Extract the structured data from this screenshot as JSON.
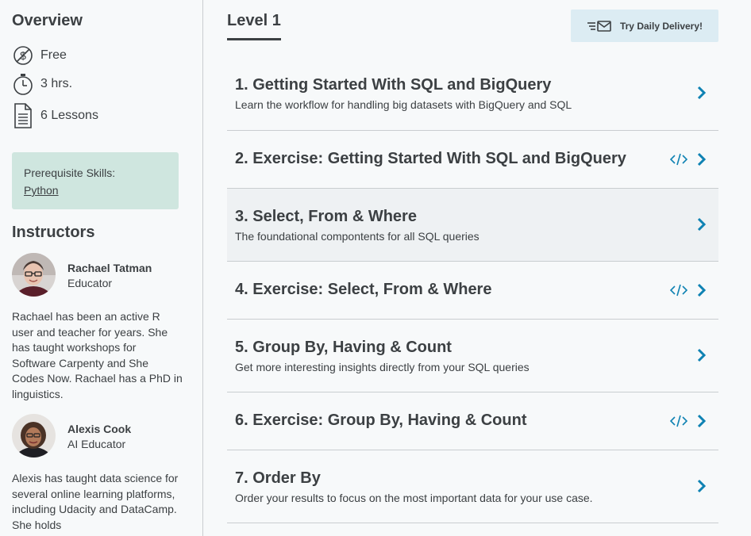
{
  "overview": {
    "title": "Overview",
    "price": "Free",
    "duration": "3 hrs.",
    "lessons_count": "6 Lessons",
    "prereq_label": "Prerequisite Skills:",
    "prereq_link": "Python"
  },
  "instructors": {
    "title": "Instructors",
    "items": [
      {
        "name": "Rachael Tatman",
        "role": "Educator",
        "bio": "Rachael has been an active R user and teacher for years. She has taught workshops for Software Carpenty and She Codes Now. Rachael has a PhD in linguistics."
      },
      {
        "name": "Alexis Cook",
        "role": "AI Educator",
        "bio": "Alexis has taught data science for several online learning platforms, including Udacity and DataCamp. She holds"
      }
    ]
  },
  "main": {
    "level_tab": "Level 1",
    "daily_delivery": "Try Daily Delivery!",
    "lessons": [
      {
        "title": "1. Getting Started With SQL and BigQuery",
        "subtitle": "Learn the workflow for handling big datasets with BigQuery and SQL",
        "exercise": false
      },
      {
        "title": "2. Exercise: Getting Started With SQL and BigQuery",
        "subtitle": "",
        "exercise": true
      },
      {
        "title": "3. Select, From & Where",
        "subtitle": "The foundational compontents for all SQL queries",
        "exercise": false
      },
      {
        "title": "4. Exercise: Select, From & Where",
        "subtitle": "",
        "exercise": true
      },
      {
        "title": "5. Group By, Having & Count",
        "subtitle": "Get more interesting insights directly from your SQL queries",
        "exercise": false
      },
      {
        "title": "6. Exercise: Group By, Having & Count",
        "subtitle": "",
        "exercise": true
      },
      {
        "title": "7. Order By",
        "subtitle": "Order your results to focus on the most important data for your use case.",
        "exercise": false
      }
    ]
  },
  "colors": {
    "accent": "#0f82b3",
    "prereq_bg": "#cfe6df",
    "button_bg": "#dcecf3"
  }
}
